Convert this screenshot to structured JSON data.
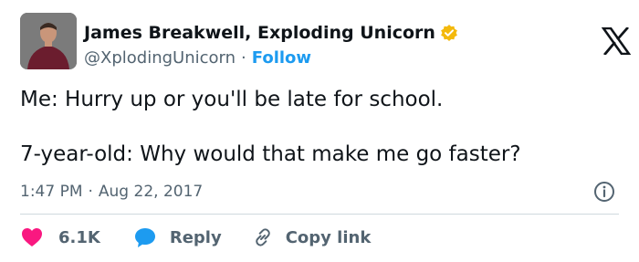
{
  "author": {
    "display_name": "James Breakwell, Exploding Unicorn",
    "handle": "@XplodingUnicorn",
    "separator": "·",
    "follow_label": "Follow",
    "verified_icon": "verified-badge-icon",
    "verified_color": "#f4b90c"
  },
  "platform_icon": "x-logo-icon",
  "tweet": {
    "line1": "Me: Hurry up or you'll be late for school.",
    "line2": "7-year-old: Why would that make me go faster?"
  },
  "meta": {
    "time": "1:47 PM",
    "separator": "·",
    "date": "Aug 22, 2017"
  },
  "actions": {
    "like_count": "6.1K",
    "like_color": "#f91880",
    "reply_label": "Reply",
    "reply_color": "#1d9bf0",
    "copy_label": "Copy link"
  },
  "colors": {
    "accent": "#1d9bf0",
    "text": "#0f1419",
    "muted": "#536471",
    "divider": "#cfd9de"
  }
}
